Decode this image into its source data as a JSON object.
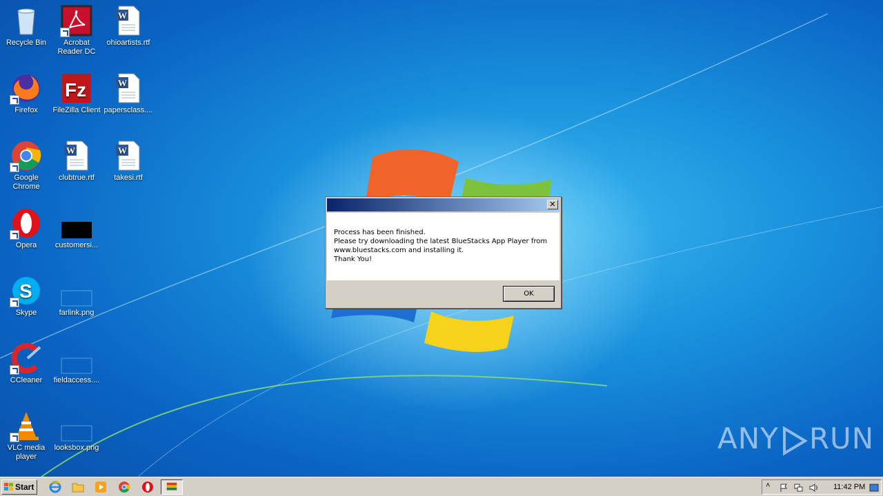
{
  "desktop": {
    "icons": [
      {
        "label": "Recycle Bin",
        "icon": "recycle-bin-icon"
      },
      {
        "label": "Acrobat Reader DC",
        "icon": "acrobat-icon"
      },
      {
        "label": "ohioartists.rtf",
        "icon": "word-doc-icon"
      },
      {
        "label": "Firefox",
        "icon": "firefox-icon"
      },
      {
        "label": "FileZilla Client",
        "icon": "filezilla-icon"
      },
      {
        "label": "papersclass....",
        "icon": "word-doc-icon"
      },
      {
        "label": "Google Chrome",
        "icon": "chrome-icon"
      },
      {
        "label": "clubtrue.rtf",
        "icon": "word-doc-icon"
      },
      {
        "label": "takesi.rtf",
        "icon": "word-doc-icon"
      },
      {
        "label": "Opera",
        "icon": "opera-icon"
      },
      {
        "label": "customersi...",
        "icon": "black-image-icon"
      },
      {
        "label": "Skype",
        "icon": "skype-icon"
      },
      {
        "label": "farlink.png",
        "icon": "png-icon"
      },
      {
        "label": "CCleaner",
        "icon": "ccleaner-icon"
      },
      {
        "label": "fieldaccess....",
        "icon": "png-icon"
      },
      {
        "label": "VLC media player",
        "icon": "vlc-icon"
      },
      {
        "label": "looksbox.png",
        "icon": "png-icon"
      }
    ]
  },
  "dialog": {
    "title": "",
    "close_label": "✕",
    "lines": [
      "Process has been finished.",
      "Please try downloading the latest BlueStacks App Player from",
      "www.bluestacks.com and installing it.",
      "Thank You!"
    ],
    "ok_label": "OK"
  },
  "taskbar": {
    "start_label": "Start",
    "quick_launch": [
      "ie-icon",
      "folder-icon",
      "media-player-icon",
      "chrome-icon",
      "opera-icon"
    ],
    "active_task_icon": "bluestacks-icon",
    "clock": "11:42 PM"
  },
  "watermark": {
    "text_left": "ANY",
    "text_right": "RUN"
  }
}
